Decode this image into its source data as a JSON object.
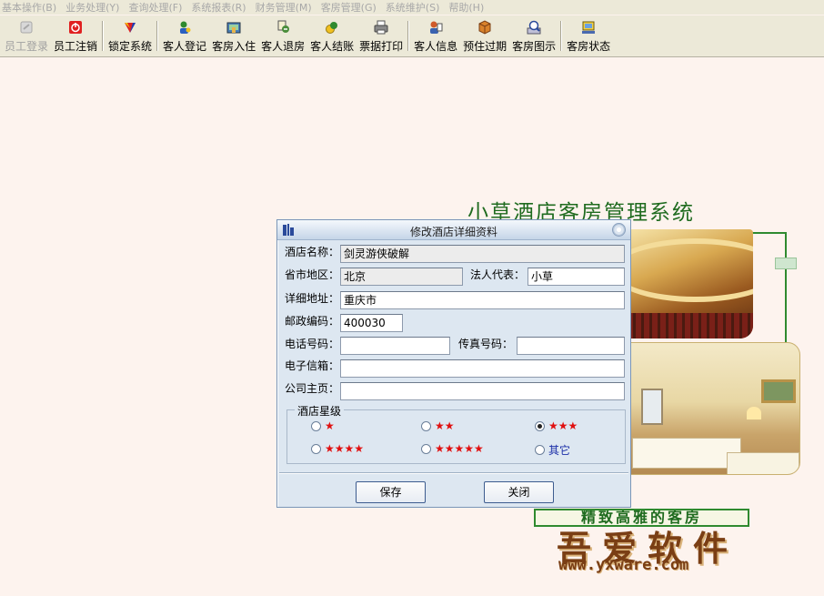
{
  "menu": [
    "基本操作(B)",
    "业务处理(Y)",
    "查询处理(F)",
    "系统报表(R)",
    "财务管理(M)",
    "客房管理(G)",
    "系统维护(S)",
    "帮助(H)"
  ],
  "toolbar": [
    {
      "label": "员工登录",
      "icon": "login-icon",
      "enabled": false
    },
    {
      "label": "员工注销",
      "icon": "power-icon",
      "enabled": true
    },
    {
      "label": "锁定系统",
      "icon": "lock-icon",
      "enabled": true
    },
    {
      "label": "客人登记",
      "icon": "guest-register-icon",
      "enabled": true
    },
    {
      "label": "客房入住",
      "icon": "checkin-icon",
      "enabled": true
    },
    {
      "label": "客人退房",
      "icon": "checkout-icon",
      "enabled": true
    },
    {
      "label": "客人结账",
      "icon": "settle-icon",
      "enabled": true
    },
    {
      "label": "票据打印",
      "icon": "printer-icon",
      "enabled": true
    },
    {
      "label": "客人信息",
      "icon": "guest-info-icon",
      "enabled": true
    },
    {
      "label": "预住过期",
      "icon": "expired-book-icon",
      "enabled": true
    },
    {
      "label": "客房图示",
      "icon": "room-graph-icon",
      "enabled": true
    },
    {
      "label": "客房状态",
      "icon": "room-status-icon",
      "enabled": true
    }
  ],
  "background": {
    "title": "小草酒店客房管理系统",
    "slogan": "精致高雅的客房",
    "watermark": "吾爱软件",
    "watermark_url": "www.yxware.com"
  },
  "dialog": {
    "title": "修改酒店详细资料",
    "labels": {
      "hotel_name": "酒店名称：",
      "region": "省市地区：",
      "legal_rep": "法人代表：",
      "address": "详细地址：",
      "postcode": "邮政编码：",
      "phone": "电话号码：",
      "fax": "传真号码：",
      "email": "电子信箱：",
      "homepage": "公司主页："
    },
    "values": {
      "hotel_name": "剑灵游侠破解",
      "region": "北京",
      "legal_rep": "小草",
      "address": "重庆市",
      "postcode": "400030",
      "phone": "",
      "fax": "",
      "email": "",
      "homepage": ""
    },
    "star_group": {
      "title": "酒店星级",
      "options": [
        {
          "label": "★",
          "checked": false
        },
        {
          "label": "★★",
          "checked": false
        },
        {
          "label": "★★★",
          "checked": true
        },
        {
          "label": "★★★★",
          "checked": false
        },
        {
          "label": "★★★★★",
          "checked": false
        },
        {
          "label": "其它",
          "checked": false
        }
      ]
    },
    "buttons": {
      "save": "保存",
      "close": "关闭"
    }
  }
}
